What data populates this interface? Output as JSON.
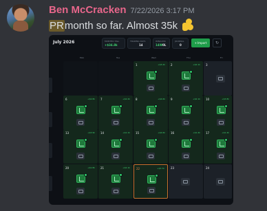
{
  "author": {
    "name": "Ben McCracken",
    "timestamp": "7/22/2026 3:17 PM"
  },
  "message": {
    "highlight": "PR",
    "text": " month so far. Almost 35k",
    "emoji": "flexed-biceps"
  },
  "calendar": {
    "month": "July 2026",
    "stats": [
      {
        "label": "MONTHLY P&L",
        "value": "+$34.8k",
        "color": "#3fcf70"
      },
      {
        "label": "TRADING DAYS",
        "value": "14",
        "color": "#e6e8eb"
      },
      {
        "label": "WIN/LOSS",
        "value": "14W",
        "value2": "0L",
        "color": "#3fcf70"
      },
      {
        "label": "JOURNAL",
        "value": "0",
        "color": "#e6e8eb"
      }
    ],
    "import_label": "Import",
    "weekdays": [
      "Mon",
      "Tue",
      "Wed",
      "Thu",
      "Fri"
    ],
    "weeks": [
      [
        {
          "day": "",
          "kind": "empty"
        },
        {
          "day": "",
          "kind": "empty"
        },
        {
          "day": "1",
          "pnl": "+$3.2k",
          "kind": "profit"
        },
        {
          "day": "2",
          "pnl": "+$2.1k",
          "kind": "profit"
        },
        {
          "day": "3",
          "kind": "none"
        }
      ],
      [
        {
          "day": "6",
          "pnl": "+$2.8k",
          "kind": "profit"
        },
        {
          "day": "7",
          "pnl": "+$2.2k",
          "kind": "profit"
        },
        {
          "day": "8",
          "pnl": "+$4.6k",
          "kind": "profit"
        },
        {
          "day": "9",
          "pnl": "+$2.1k",
          "kind": "profit"
        },
        {
          "day": "10",
          "pnl": "+$3.8k",
          "kind": "profit"
        }
      ],
      [
        {
          "day": "13",
          "pnl": "+$3.9k",
          "kind": "profit"
        },
        {
          "day": "14",
          "pnl": "+$1.1k",
          "kind": "profit"
        },
        {
          "day": "15",
          "pnl": "+$4.6k",
          "kind": "profit"
        },
        {
          "day": "16",
          "pnl": "+$1.4k",
          "kind": "profit"
        },
        {
          "day": "17",
          "pnl": "+$1.4k",
          "kind": "profit"
        }
      ],
      [
        {
          "day": "20",
          "pnl": "+$1.8k",
          "kind": "profit"
        },
        {
          "day": "21",
          "pnl": "+$2.1k",
          "kind": "profit"
        },
        {
          "day": "22",
          "pnl": "+$3.7k",
          "kind": "today"
        },
        {
          "day": "23",
          "kind": "none"
        },
        {
          "day": "24",
          "kind": "none"
        }
      ]
    ]
  }
}
